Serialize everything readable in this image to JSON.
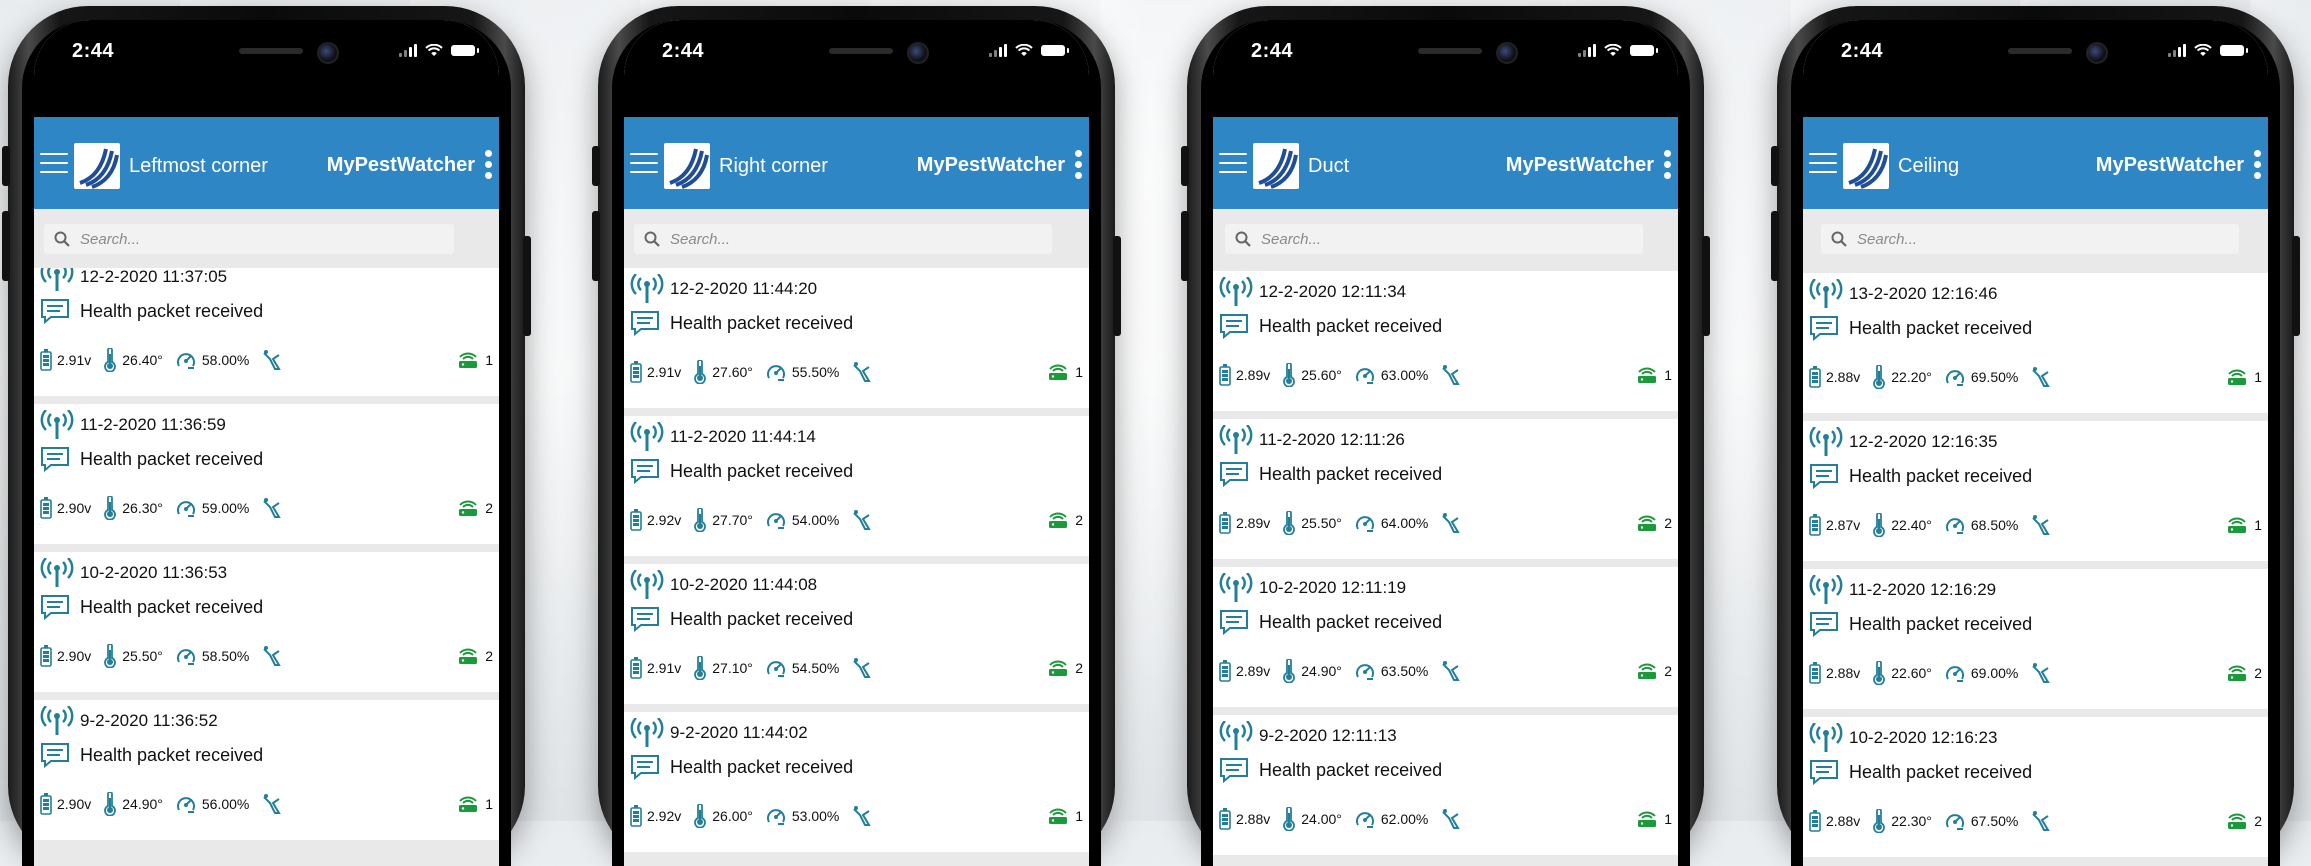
{
  "phones": [
    {
      "time": "2:44",
      "title": "Leftmost corner",
      "brand": "MyPestWatcher",
      "search_placeholder": "Search...",
      "records": [
        {
          "date": "12-2-2020 11:37:05",
          "message": "Health packet received",
          "voltage": "2.91v",
          "temperature": "26.40°",
          "humidity": "58.00%",
          "gateways": "1"
        },
        {
          "date": "11-2-2020 11:36:59",
          "message": "Health packet received",
          "voltage": "2.90v",
          "temperature": "26.30°",
          "humidity": "59.00%",
          "gateways": "2"
        },
        {
          "date": "10-2-2020 11:36:53",
          "message": "Health packet received",
          "voltage": "2.90v",
          "temperature": "25.50°",
          "humidity": "58.50%",
          "gateways": "2"
        },
        {
          "date": "9-2-2020 11:36:52",
          "message": "Health packet received",
          "voltage": "2.90v",
          "temperature": "24.90°",
          "humidity": "56.00%",
          "gateways": "1"
        }
      ]
    },
    {
      "time": "2:44",
      "title": "Right corner",
      "brand": "MyPestWatcher",
      "search_placeholder": "Search...",
      "records": [
        {
          "date": "12-2-2020 11:44:20",
          "message": "Health packet received",
          "voltage": "2.91v",
          "temperature": "27.60°",
          "humidity": "55.50%",
          "gateways": "1"
        },
        {
          "date": "11-2-2020 11:44:14",
          "message": "Health packet received",
          "voltage": "2.92v",
          "temperature": "27.70°",
          "humidity": "54.00%",
          "gateways": "2"
        },
        {
          "date": "10-2-2020 11:44:08",
          "message": "Health packet received",
          "voltage": "2.91v",
          "temperature": "27.10°",
          "humidity": "54.50%",
          "gateways": "2"
        },
        {
          "date": "9-2-2020 11:44:02",
          "message": "Health packet received",
          "voltage": "2.92v",
          "temperature": "26.00°",
          "humidity": "53.00%",
          "gateways": "1"
        }
      ]
    },
    {
      "time": "2:44",
      "title": "Duct",
      "brand": "MyPestWatcher",
      "search_placeholder": "Search...",
      "records": [
        {
          "date": "12-2-2020 12:11:34",
          "message": "Health packet received",
          "voltage": "2.89v",
          "temperature": "25.60°",
          "humidity": "63.00%",
          "gateways": "1"
        },
        {
          "date": "11-2-2020 12:11:26",
          "message": "Health packet received",
          "voltage": "2.89v",
          "temperature": "25.50°",
          "humidity": "64.00%",
          "gateways": "2"
        },
        {
          "date": "10-2-2020 12:11:19",
          "message": "Health packet received",
          "voltage": "2.89v",
          "temperature": "24.90°",
          "humidity": "63.50%",
          "gateways": "2"
        },
        {
          "date": "9-2-2020 12:11:13",
          "message": "Health packet received",
          "voltage": "2.88v",
          "temperature": "24.00°",
          "humidity": "62.00%",
          "gateways": "1"
        }
      ]
    },
    {
      "time": "2:44",
      "title": "Ceiling",
      "brand": "MyPestWatcher",
      "search_placeholder": "Search...",
      "records": [
        {
          "date": "13-2-2020 12:16:46",
          "message": "Health packet received",
          "voltage": "2.88v",
          "temperature": "22.20°",
          "humidity": "69.50%",
          "gateways": "1"
        },
        {
          "date": "12-2-2020 12:16:35",
          "message": "Health packet received",
          "voltage": "2.87v",
          "temperature": "22.40°",
          "humidity": "68.50%",
          "gateways": "1"
        },
        {
          "date": "11-2-2020 12:16:29",
          "message": "Health packet received",
          "voltage": "2.88v",
          "temperature": "22.60°",
          "humidity": "69.00%",
          "gateways": "2"
        },
        {
          "date": "10-2-2020 12:16:23",
          "message": "Health packet received",
          "voltage": "2.88v",
          "temperature": "22.30°",
          "humidity": "67.50%",
          "gateways": "2"
        }
      ]
    }
  ],
  "colors": {
    "appbar": "#2f86c5",
    "icon_teal": "#227f9a",
    "gateway_green": "#1a9a3a",
    "logo_blue": "#1f4e96"
  },
  "icons": {
    "menu": "hamburger-icon",
    "logo": "pestwatcher-logo",
    "overflow": "more-vert-icon",
    "search": "search-icon",
    "date": "antenna-icon",
    "message": "message-icon",
    "voltage": "battery-icon",
    "temperature": "thermometer-icon",
    "humidity": "gauge-icon",
    "trap": "trap-icon",
    "gateway": "gateway-icon"
  }
}
